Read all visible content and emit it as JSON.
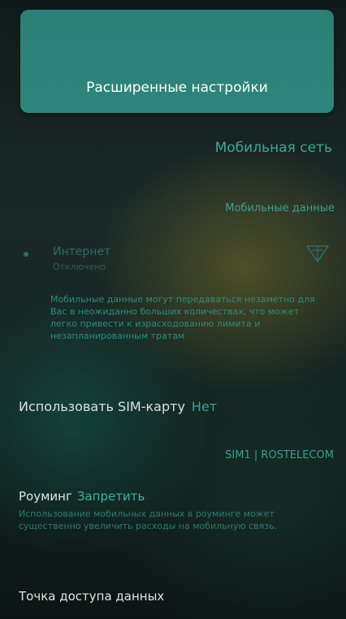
{
  "header": {
    "title": "Расширенные настройки"
  },
  "mobile_network": {
    "section_title": "Мобильная сеть",
    "subsection_title": "Мобильные данные",
    "internet": {
      "label": "Интернет",
      "status": "Отключено",
      "enabled": false
    },
    "warning": "Мобильные данные могут передаваться незаметно для Вас в неожиданно больших количествах, что может легко привести к израсходованию лимита и незапланированным тратам",
    "sim": {
      "label": "Использовать SIM-карту",
      "value": "Нет",
      "sim_name": "SIM1 | ROSTELECOM"
    },
    "roaming": {
      "label": "Роуминг",
      "value": "Запретить",
      "description": "Использование мобильных данных в роуминге может существенно увеличить расходы на мобильную связь."
    },
    "apn": {
      "label": "Точка доступа данных"
    }
  },
  "colors": {
    "accent": "#2b7f76",
    "link": "#3aa493"
  }
}
